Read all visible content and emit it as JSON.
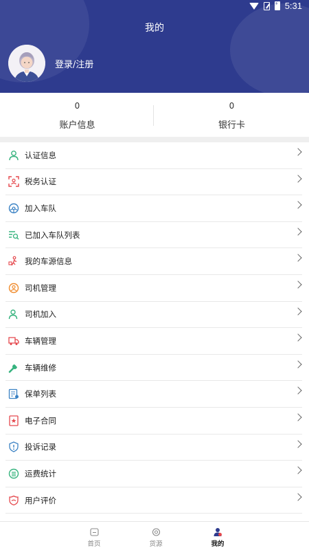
{
  "status_bar": {
    "time": "5:31"
  },
  "header": {
    "title": "我的",
    "login_label": "登录/注册"
  },
  "stats": [
    {
      "value": "0",
      "label": "账户信息"
    },
    {
      "value": "0",
      "label": "银行卡"
    }
  ],
  "menu": [
    {
      "label": "认证信息",
      "icon": "user-check-icon",
      "color": "#36b37e"
    },
    {
      "label": "税务认证",
      "icon": "scan-icon",
      "color": "#e5484d"
    },
    {
      "label": "加入车队",
      "icon": "steering-wheel-icon",
      "color": "#3b82c4"
    },
    {
      "label": "已加入车队列表",
      "icon": "list-search-icon",
      "color": "#36b37e"
    },
    {
      "label": "我的车源信息",
      "icon": "person-cart-icon",
      "color": "#e5484d"
    },
    {
      "label": "司机管理",
      "icon": "driver-icon",
      "color": "#f08c2e"
    },
    {
      "label": "司机加入",
      "icon": "user-add-icon",
      "color": "#36b37e"
    },
    {
      "label": "车辆管理",
      "icon": "truck-icon",
      "color": "#e5484d"
    },
    {
      "label": "车辆维修",
      "icon": "wrench-icon",
      "color": "#36b37e"
    },
    {
      "label": "保单列表",
      "icon": "policy-icon",
      "color": "#3b82c4"
    },
    {
      "label": "电子合同",
      "icon": "contract-icon",
      "color": "#e5484d"
    },
    {
      "label": "投诉记录",
      "icon": "shield-alert-icon",
      "color": "#3b82c4"
    },
    {
      "label": "运费统计",
      "icon": "stats-icon",
      "color": "#36b37e"
    },
    {
      "label": "用户评价",
      "icon": "rating-icon",
      "color": "#e5484d"
    }
  ],
  "tabs": [
    {
      "label": "首页",
      "icon": "home-icon"
    },
    {
      "label": "货源",
      "icon": "cargo-icon"
    },
    {
      "label": "我的",
      "icon": "profile-icon",
      "active": true
    }
  ],
  "colors": {
    "header_bg": "#2e3b8e",
    "active_tab_icon": "#2e3b8e"
  }
}
